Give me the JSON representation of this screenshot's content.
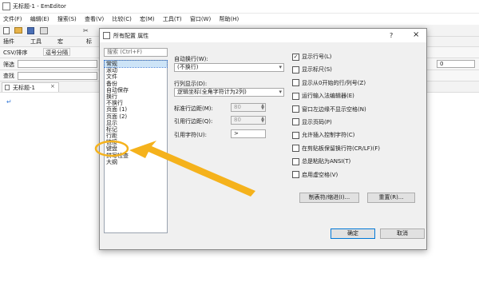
{
  "app": {
    "title": "无标题-1 - EmEditor",
    "menus": [
      "文件(F)",
      "编辑(E)",
      "搜索(S)",
      "查看(V)",
      "比较(C)",
      "宏(M)",
      "工具(T)",
      "窗口(W)",
      "帮助(H)"
    ],
    "toolbar2_labels": [
      "插件",
      "工具",
      "宏",
      "标"
    ],
    "row_csv": "CSV/排序",
    "row_csv_btn": "逗号分隔",
    "row_filter": "筛选",
    "row_find": "查找",
    "tab": "无标题-1",
    "tab_close": "×",
    "right_zero": "0"
  },
  "dialog": {
    "title": "所有配置 属性",
    "help": "?",
    "close": "×",
    "search_placeholder": "搜索 (Ctrl+F)",
    "categories": [
      "常规",
      "滚动",
      "文件",
      "备份",
      "自动保存",
      "换行",
      "不换行",
      "页面 (1)",
      "页面 (2)",
      "显示",
      "标记",
      "行距",
      "链接",
      "键盘",
      "拼写检查",
      "大纲"
    ],
    "selected_category": "常规",
    "auto_wrap_label": "自动换行(W):",
    "auto_wrap_value": "(不换行)",
    "row_display_label": "行列显示(D):",
    "row_display_value": "逻辑坐标(全角字符计为2列)",
    "std_indent_label": "标准行边距(M):",
    "std_indent_value": "80",
    "quote_indent_label": "引用行边距(Q):",
    "quote_indent_value": "80",
    "quote_char_label": "引用字符(U):",
    "quote_char_value": ">",
    "checkboxes": [
      {
        "label": "显示行号(L)",
        "checked": true
      },
      {
        "label": "显示标尺(S)",
        "checked": false
      },
      {
        "label": "显示从0开始的行/列号(Z)",
        "checked": false
      },
      {
        "label": "运行输入法编辑器(E)",
        "checked": false
      },
      {
        "label": "窗口左边缘不显示空格(N)",
        "checked": false
      },
      {
        "label": "显示页码(P)",
        "checked": false
      },
      {
        "label": "允许插入控制字符(C)",
        "checked": false
      },
      {
        "label": "在剪贴板保留换行符(CR/LF)(F)",
        "checked": false
      },
      {
        "label": "总是粘贴为ANSI(T)",
        "checked": false
      },
      {
        "label": "启用虚空格(V)",
        "checked": false
      }
    ],
    "tab_indent_button": "制表符/缩进(I)...",
    "reset_button": "重置(R)...",
    "ok_button": "确定",
    "cancel_button": "取消"
  },
  "colors": {
    "arrow": "#f5b21c",
    "highlight_circle": "#f5b21c",
    "selection": "#cde4f7"
  }
}
